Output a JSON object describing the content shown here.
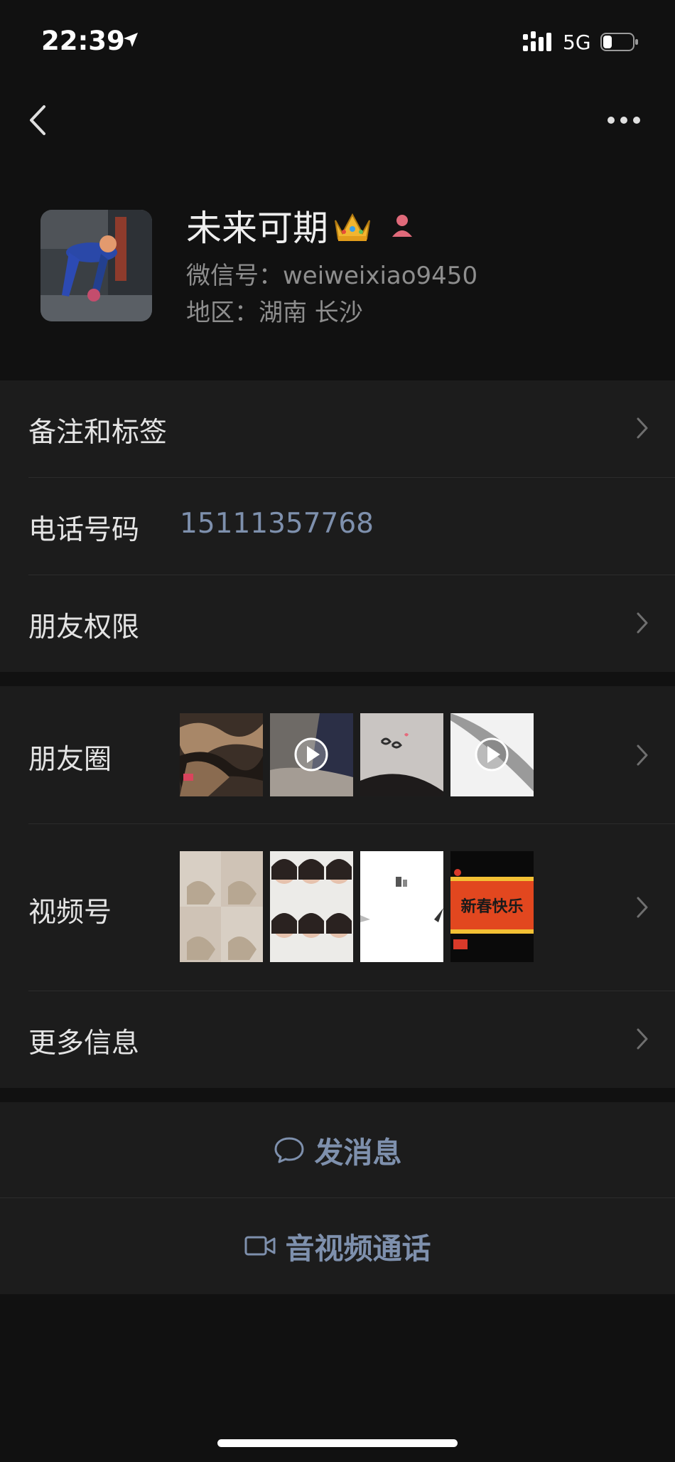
{
  "status_bar": {
    "time": "22:39",
    "network": "5G",
    "battery_level": 0.3
  },
  "profile": {
    "name": "未来可期",
    "wechat_id": "微信号：weiweixiao9450",
    "region": "地区：湖南 长沙"
  },
  "menu": {
    "remarks_tags": "备注和标签",
    "phone_label": "电话号码",
    "phone_value": "15111357768",
    "friend_permissions": "朋友权限"
  },
  "media": {
    "moments_label": "朋友圈",
    "channels_label": "视频号",
    "more_info": "更多信息"
  },
  "channel_thumb_text": "新春快乐",
  "actions": {
    "send_message": "发消息",
    "av_call": "音视频通话"
  },
  "colors": {
    "accent_link": "#7e90ad",
    "background": "#111111",
    "panel": "#1c1c1c"
  }
}
